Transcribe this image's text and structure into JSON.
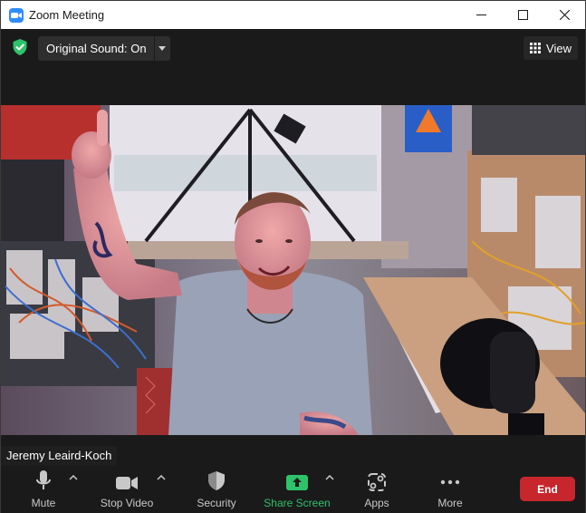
{
  "window": {
    "title": "Zoom Meeting",
    "controls": [
      "minimize",
      "maximize",
      "close"
    ]
  },
  "topbar": {
    "sound_label": "Original Sound: On",
    "view_label": "View",
    "icons": [
      "shield-check-icon",
      "chevron-down-icon",
      "grid-icon"
    ]
  },
  "participant": {
    "name": "Jeremy Leaird-Koch"
  },
  "toolbar": {
    "mute": "Mute",
    "stop_video": "Stop Video",
    "security": "Security",
    "share_screen": "Share Screen",
    "apps": "Apps",
    "more": "More",
    "end": "End"
  },
  "colors": {
    "accent_green": "#2ec26a",
    "end_red": "#c7262c",
    "zoom_blue": "#2d8cff"
  }
}
